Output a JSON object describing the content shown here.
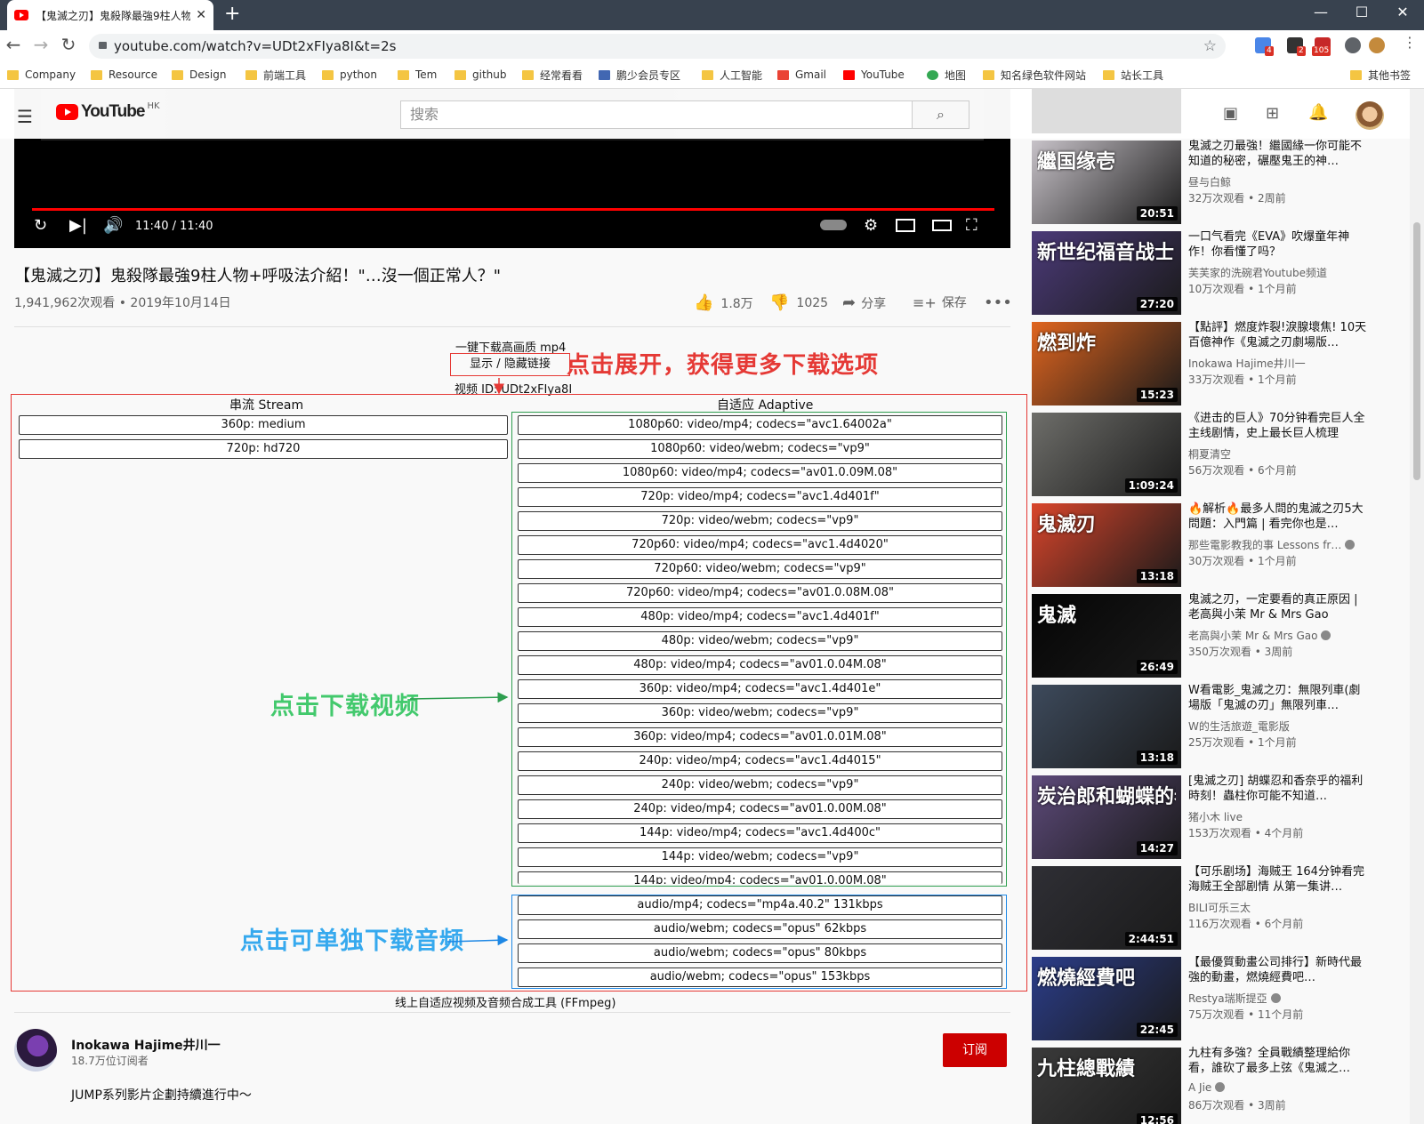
{
  "browser": {
    "tab_title": "【鬼滅之刃】鬼殺隊最強9柱人物",
    "url": "youtube.com/watch?v=UDt2xFIya8I&t=2s",
    "bookmarks": [
      "Company",
      "Resource",
      "Design",
      "前端工具",
      "python",
      "Tem",
      "github",
      "经常看看",
      "鹏少会员专区",
      "人工智能",
      "Gmail",
      "YouTube",
      "地图",
      "知名绿色软件网站",
      "站长工具"
    ],
    "other_bookmarks": "其他书签",
    "ext_badges": [
      "4",
      "2",
      "105"
    ]
  },
  "header": {
    "logo_text": "YouTube",
    "region": "HK",
    "search_placeholder": "搜索"
  },
  "player": {
    "time": "11:40 / 11:40"
  },
  "video": {
    "title": "【鬼滅之刃】鬼殺隊最強9柱人物+呼吸法介紹！\"…沒一個正常人？\"",
    "meta": "1,941,962次观看 • 2019年10月14日",
    "likes": "1.8万",
    "dislikes": "1025",
    "share": "分享",
    "save": "保存"
  },
  "downloader": {
    "one_click": "一键下载高画质 mp4",
    "show_hide": "显示 / 隐藏链接",
    "video_id": "视频 ID: UDt2xFIya8I",
    "stream_header": "串流 Stream",
    "adaptive_header": "自适应 Adaptive",
    "stream_items": [
      "360p: medium",
      "720p: hd720"
    ],
    "adaptive_items": [
      "1080p60: video/mp4; codecs=\"avc1.64002a\"",
      "1080p60: video/webm; codecs=\"vp9\"",
      "1080p60: video/mp4; codecs=\"av01.0.09M.08\"",
      "720p: video/mp4; codecs=\"avc1.4d401f\"",
      "720p: video/webm; codecs=\"vp9\"",
      "720p60: video/mp4; codecs=\"avc1.4d4020\"",
      "720p60: video/webm; codecs=\"vp9\"",
      "720p60: video/mp4; codecs=\"av01.0.08M.08\"",
      "480p: video/mp4; codecs=\"avc1.4d401f\"",
      "480p: video/webm; codecs=\"vp9\"",
      "480p: video/mp4; codecs=\"av01.0.04M.08\"",
      "360p: video/mp4; codecs=\"avc1.4d401e\"",
      "360p: video/webm; codecs=\"vp9\"",
      "360p: video/mp4; codecs=\"av01.0.01M.08\"",
      "240p: video/mp4; codecs=\"avc1.4d4015\"",
      "240p: video/webm; codecs=\"vp9\"",
      "240p: video/mp4; codecs=\"av01.0.00M.08\"",
      "144p: video/mp4; codecs=\"avc1.4d400c\"",
      "144p: video/webm; codecs=\"vp9\"",
      "144p: video/mp4; codecs=\"av01.0.00M.08\""
    ],
    "audio_items": [
      "audio/mp4; codecs=\"mp4a.40.2\" 131kbps",
      "audio/webm; codecs=\"opus\" 62kbps",
      "audio/webm; codecs=\"opus\" 80kbps",
      "audio/webm; codecs=\"opus\" 153kbps"
    ],
    "ffmpeg_link": "线上自适应视频及音频合成工具 (FFmpeg)"
  },
  "annotations": {
    "expand": "点击展开，获得更多下载选项",
    "download_video": "点击下载视频",
    "download_audio": "点击可单独下载音频"
  },
  "channel": {
    "name": "Inokawa Hajime井川一",
    "subscribers": "18.7万位订阅者",
    "subscribe": "订阅",
    "description": "JUMP系列影片企劃持續進行中～"
  },
  "recommendations": [
    {
      "title": "鬼滅之刃最強！繼國緣一你可能不知道的秘密，碾壓鬼王的神…",
      "channel": "昼与白鲸",
      "views": "32万次观看 • 2周前",
      "duration": "20:51",
      "verified": false,
      "thumb": "#c7c2c8",
      "overlay": "繼国缘壱"
    },
    {
      "title": "一口气看完《EVA》吹爆童年神作！你看懂了吗？",
      "channel": "芙芙家的洗碗君Youtube频道",
      "views": "10万次观看 • 1个月前",
      "duration": "27:20",
      "verified": false,
      "thumb": "#4b3a78",
      "overlay": "新世纪福音战士"
    },
    {
      "title": "【點評】燃度炸裂!淚腺壞焦! 10天百億神作《鬼滅之刃劇場版…",
      "channel": "Inokawa Hajime井川一",
      "views": "33万次观看 • 1个月前",
      "duration": "15:23",
      "verified": false,
      "thumb": "#e0651f",
      "overlay": "燃到炸"
    },
    {
      "title": "《进击的巨人》70分钟看完巨人全主线剧情，史上最长巨人梳理",
      "channel": "桐夏清空",
      "views": "56万次观看 • 6个月前",
      "duration": "1:09:24",
      "verified": false,
      "thumb": "#6e6e6a",
      "overlay": ""
    },
    {
      "title": "🔥解析🔥最多人問的鬼滅之刃5大問題：入門篇 | 看完你也是…",
      "channel": "那些電影教我的事 Lessons fr…",
      "views": "30万次观看 • 1个月前",
      "duration": "13:18",
      "verified": true,
      "thumb": "#d9452b",
      "overlay": "鬼滅刃"
    },
    {
      "title": "鬼滅之刃，一定要看的真正原因 | 老高與小茉 Mr & Mrs Gao",
      "channel": "老高與小茉 Mr & Mrs Gao",
      "views": "350万次观看 • 3周前",
      "duration": "26:49",
      "verified": true,
      "thumb": "#050505",
      "overlay": "鬼滅"
    },
    {
      "title": "W看電影_鬼滅之刃：無限列車(劇場版「鬼滅の刃」無限列車…",
      "channel": "W的生活旅遊_電影版",
      "views": "25万次观看 • 1个月前",
      "duration": "13:18",
      "verified": false,
      "thumb": "#3d4a5c",
      "overlay": ""
    },
    {
      "title": "[鬼滅之刃] 胡蝶忍和香奈乎的福利時刻！蟲柱你可能不知道…",
      "channel": "猪小木 live",
      "views": "153万次观看 • 4个月前",
      "duration": "14:27",
      "verified": false,
      "thumb": "#5d4a7a",
      "overlay": "炭治郎和蝴蝶的老婆?"
    },
    {
      "title": "【可乐剧场】海贼王 164分钟看完海贼王全部剧情 从第一集讲…",
      "channel": "BILI可乐三太",
      "views": "116万次观看 • 6个月前",
      "duration": "2:44:51",
      "verified": false,
      "thumb": "#2f2f35",
      "overlay": ""
    },
    {
      "title": "【最優質動畫公司排行】新時代最強的動畫，燃燒經費吧…",
      "channel": "Restya瑞斯提亞",
      "views": "75万次观看 • 11个月前",
      "duration": "22:45",
      "verified": true,
      "thumb": "#2b3d8a",
      "overlay": "燃燒經費吧"
    },
    {
      "title": "九柱有多強？全員戰績整理給你看，誰砍了最多上弦《鬼滅之…",
      "channel": "A Jie",
      "views": "86万次观看 • 3周前",
      "duration": "12:56",
      "verified": true,
      "thumb": "#3a3a3a",
      "overlay": "九柱總戰績"
    }
  ]
}
